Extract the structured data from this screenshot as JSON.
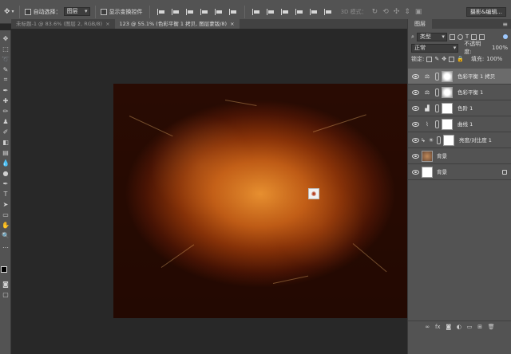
{
  "options_bar": {
    "auto_select_label": "自动选择：",
    "auto_select_value": "图层",
    "transform_controls_label": "显示变换控件",
    "mode_3d_label": "3D 模式：",
    "workspace_button": "摄影&编辑..."
  },
  "tabs": [
    {
      "label": "未标题-1 @ 83.6% (图层 2, RGB/8)",
      "close": "×",
      "active": false
    },
    {
      "label": "123 @ 55.1% (色彩平衡 1 拷贝, 图层蒙版/8)",
      "close": "×",
      "active": true
    }
  ],
  "layers_panel": {
    "title": "图层",
    "menu_glyph": "≡",
    "filter_type": "类型",
    "blend_mode": "正常",
    "opacity_label": "不透明度:",
    "opacity_value": "100%",
    "lock_label": "锁定:",
    "fill_label": "填充:",
    "fill_value": "100%",
    "layers": [
      {
        "name": "色彩平衡 1 拷贝",
        "adjustment_icon": "balance-icon",
        "selected": true
      },
      {
        "name": "色彩平衡 1",
        "adjustment_icon": "balance-icon",
        "selected": false
      },
      {
        "name": "色阶 1",
        "adjustment_icon": "levels-icon",
        "selected": false
      },
      {
        "name": "曲线 1",
        "adjustment_icon": "curves-icon",
        "selected": false
      },
      {
        "name": "亮度/对比度 1",
        "adjustment_icon": "brightness-icon",
        "selected": false
      },
      {
        "name": "背景",
        "adjustment_icon": "",
        "selected": false
      },
      {
        "name": "背景",
        "adjustment_icon": "",
        "selected": false,
        "locked": true
      }
    ],
    "footer_icons": [
      "link-icon",
      "fx-icon",
      "mask-icon",
      "adjustment-icon",
      "group-icon",
      "new-layer-icon",
      "trash-icon"
    ]
  }
}
